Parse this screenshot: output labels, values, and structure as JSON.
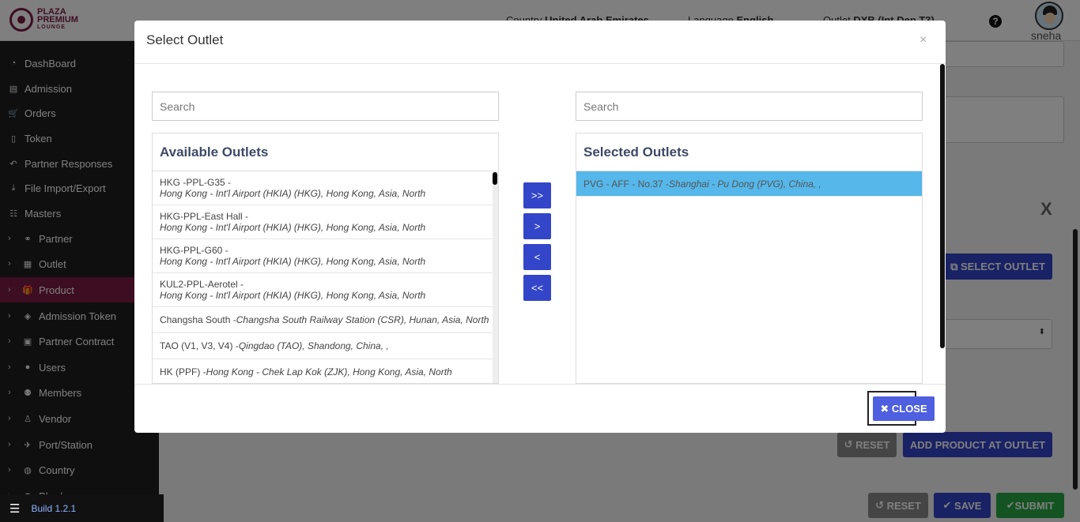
{
  "header": {
    "logo_top": "PLAZA",
    "logo_mid": "PREMIUM",
    "logo_bottom": "LOUNGE",
    "country_label": "Country",
    "country_value": "United Arab Emirates",
    "language_label": "Language",
    "language_value": "English",
    "outlet_label": "Outlet",
    "outlet_value": "DXB (Int Dep T3)",
    "user": "sneha"
  },
  "sidebar": {
    "items": [
      {
        "label": "DashBoard",
        "icon": "dashboard-icon"
      },
      {
        "label": "Admission",
        "icon": "id-card-icon"
      },
      {
        "label": "Orders",
        "icon": "cart-icon"
      },
      {
        "label": "Token",
        "icon": "file-icon"
      },
      {
        "label": "Partner Responses",
        "icon": "reply-icon"
      },
      {
        "label": "File Import/Export",
        "icon": "download-icon"
      },
      {
        "label": "Masters",
        "icon": "sitemap-icon"
      },
      {
        "label": "Partner",
        "icon": "handshake-icon"
      },
      {
        "label": "Outlet",
        "icon": "building-icon"
      },
      {
        "label": "Product",
        "icon": "gift-icon"
      },
      {
        "label": "Admission Token",
        "icon": "tag-icon"
      },
      {
        "label": "Partner Contract",
        "icon": "briefcase-icon"
      },
      {
        "label": "Users",
        "icon": "user-icon"
      },
      {
        "label": "Members",
        "icon": "users-icon"
      },
      {
        "label": "Vendor",
        "icon": "person-icon"
      },
      {
        "label": "Port/Station",
        "icon": "plane-icon"
      },
      {
        "label": "Country",
        "icon": "globe-icon"
      },
      {
        "label": "Plan/...",
        "icon": "cog-icon"
      }
    ],
    "build": "Build 1.2.1"
  },
  "background": {
    "select_outlet_label": "SELECT OUTLET",
    "reset_label": "RESET",
    "add_product_label": "ADD PRODUCT AT OUTLET",
    "reset2_label": "RESET",
    "save_label": "SAVE",
    "submit_label": "SUBMIT",
    "close_x": "X"
  },
  "modal": {
    "title": "Select Outlet",
    "close_x": "×",
    "available": {
      "search_placeholder": "Search",
      "title": "Available Outlets",
      "items": [
        {
          "code": "HKG -PPL-G35 -",
          "location": "Hong Kong - Int'l Airport (HKIA) (HKG), Hong Kong, Asia, North",
          "two_line": true
        },
        {
          "code": "HKG-PPL-East Hall -",
          "location": "Hong Kong - Int'l Airport (HKIA) (HKG), Hong Kong, Asia, North",
          "two_line": true
        },
        {
          "code": "HKG-PPL-G60 -",
          "location": "Hong Kong - Int'l Airport (HKIA) (HKG), Hong Kong, Asia, North",
          "two_line": true
        },
        {
          "code": "KUL2-PPL-Aerotel -",
          "location": "Hong Kong - Int'l Airport (HKIA) (HKG), Hong Kong, Asia, North",
          "two_line": true
        },
        {
          "code": "Changsha South -",
          "location": "Changsha South Railway Station (CSR), Hunan, Asia, North",
          "two_line": false
        },
        {
          "code": "TAO (V1, V3, V4) -",
          "location": "Qingdao (TAO), Shandong, China, ,",
          "two_line": false
        },
        {
          "code": "HK (PPF) -",
          "location": "Hong Kong - Chek Lap Kok (ZJK), Hong Kong, Asia, North",
          "two_line": false
        }
      ]
    },
    "selected": {
      "search_placeholder": "Search",
      "title": "Selected Outlets",
      "items": [
        {
          "code": "PVG - AFF - No.37 -",
          "location": "Shanghai - Pu Dong (PVG), China, ,"
        }
      ]
    },
    "buttons": {
      "move_all_right": ">>",
      "move_right": ">",
      "move_left": "<",
      "move_all_left": "<<",
      "close": "CLOSE"
    }
  }
}
